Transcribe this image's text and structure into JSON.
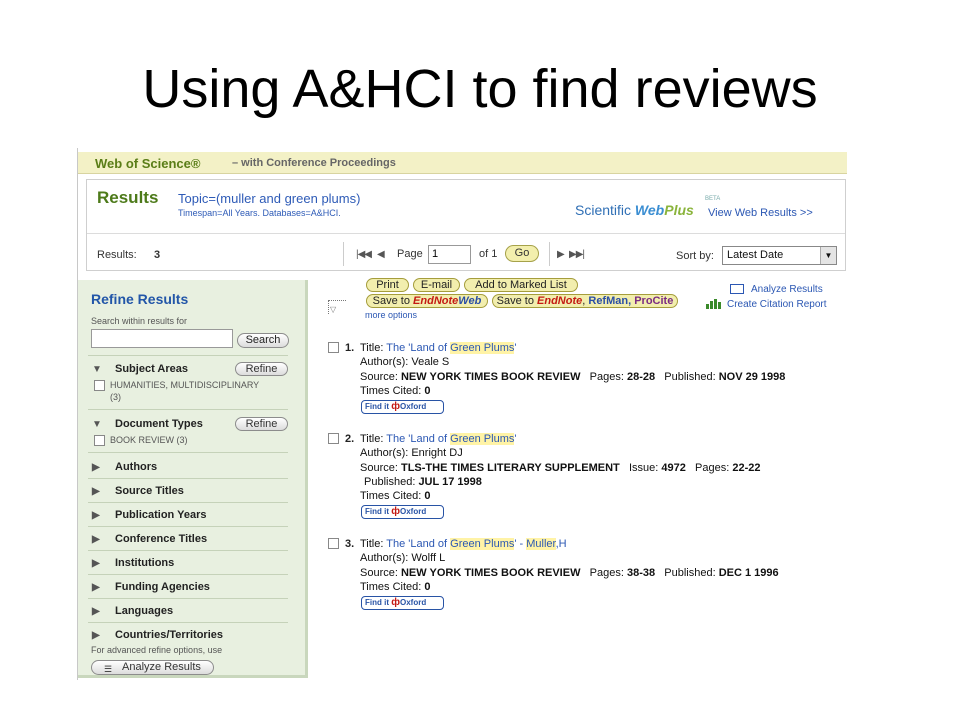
{
  "slide": {
    "title": "Using A&HCI to find reviews"
  },
  "wos": {
    "brand": "Web of Science®",
    "subtitle": "– with Conference Proceedings"
  },
  "results_header": {
    "heading": "Results",
    "topic": "Topic=(muller and green plums)",
    "timespan": "Timespan=All Years. Databases=A&HCI.",
    "webplus_scientific": "Scientific",
    "webplus_web": "Web",
    "webplus_plus": "Plus",
    "webplus_beta": "BETA",
    "view_web_results": "View Web Results >>"
  },
  "pager": {
    "results_label": "Results:",
    "results_count": "3",
    "first_icon": "|◀◀",
    "prev_icon": "◀",
    "page_label": "Page",
    "page_value": "1",
    "of_label": "of 1",
    "go_label": "Go",
    "next_icon": "▶",
    "last_icon": "▶▶|",
    "sort_label": "Sort by:",
    "sort_value": "Latest Date"
  },
  "toolbar": {
    "print": "Print",
    "email": "E-mail",
    "add_marked": "Add to Marked List",
    "save_to": "Save to",
    "endnote": "EndNote",
    "web": "Web",
    "save_to2": "Save to",
    "endnote2": "EndNote",
    "refman": "RefMan,",
    "procite": "ProCite",
    "more_options": "more options",
    "analyze_results": "Analyze Results",
    "create_citation_report": "Create Citation Report"
  },
  "sidebar": {
    "heading": "Refine Results",
    "search_label": "Search within results for",
    "search_button": "Search",
    "refine_label": "Refine",
    "subject_areas": "Subject Areas",
    "subject_facet": "HUMANITIES, MULTIDISCIPLINARY",
    "subject_facet_count": "(3)",
    "document_types": "Document Types",
    "doctype_facet": "BOOK REVIEW (3)",
    "collapsed": [
      "Authors",
      "Source Titles",
      "Publication Years",
      "Conference Titles",
      "Institutions",
      "Funding Agencies",
      "Languages",
      "Countries/Territories"
    ],
    "advanced_text": "For advanced refine options, use",
    "analyze_button": "Analyze Results"
  },
  "records": [
    {
      "num": "1.",
      "title_label": "Title:",
      "title_pre": "The 'Land of ",
      "title_hl": "Green Plums",
      "title_post": "'",
      "title_muller": "",
      "authors": "Author(s): Veale S",
      "source_label": "Source:",
      "source": "NEW YORK TIMES BOOK REVIEW",
      "issue_label": "",
      "issue": "",
      "pages_label": "Pages:",
      "pages": "28-28",
      "published_label": "Published:",
      "published": "NOV 29 1998",
      "cited_label": "Times Cited:",
      "cited": "0",
      "findit": "Find it",
      "oxford": "Oxford"
    },
    {
      "num": "2.",
      "title_label": "Title:",
      "title_pre": "The 'Land of ",
      "title_hl": "Green Plums",
      "title_post": "'",
      "title_muller": "",
      "authors": "Author(s): Enright DJ",
      "source_label": "Source:",
      "source": "TLS-THE TIMES LITERARY SUPPLEMENT",
      "issue_label": "Issue:",
      "issue": "4972",
      "pages_label": "Pages:",
      "pages": "22-22",
      "published_label": "Published:",
      "published": "JUL 17 1998",
      "cited_label": "Times Cited:",
      "cited": "0",
      "findit": "Find it",
      "oxford": "Oxford"
    },
    {
      "num": "3.",
      "title_label": "Title:",
      "title_pre": "The 'Land of ",
      "title_hl": "Green Plums",
      "title_post": "' - ",
      "title_muller": "Muller",
      "title_tail": ",H",
      "authors": "Author(s): Wolff L",
      "source_label": "Source:",
      "source": "NEW YORK TIMES BOOK REVIEW",
      "issue_label": "",
      "issue": "",
      "pages_label": "Pages:",
      "pages": "38-38",
      "published_label": "Published:",
      "published": "DEC 1 1996",
      "cited_label": "Times Cited:",
      "cited": "0",
      "findit": "Find it",
      "oxford": "Oxford"
    }
  ]
}
